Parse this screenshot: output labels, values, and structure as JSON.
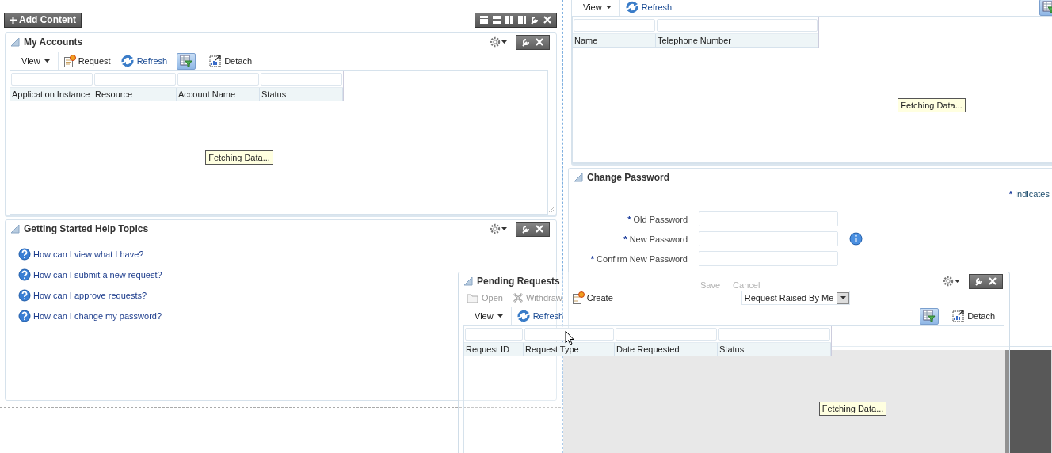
{
  "header": {
    "add_content": "Add Content"
  },
  "my_accounts": {
    "title": "My Accounts",
    "toolbar": [
      {
        "kind": "menu",
        "label": "View"
      },
      {
        "kind": "new",
        "label": "Request"
      },
      {
        "kind": "refresh",
        "label": "Refresh"
      },
      {
        "kind": "filter",
        "selected": true
      },
      {
        "kind": "detach",
        "label": "Detach"
      }
    ],
    "columns": [
      "Application Instance",
      "Resource",
      "Account Name",
      "Status"
    ],
    "status": "Fetching Data..."
  },
  "help_topics": {
    "title": "Getting Started Help Topics",
    "links": [
      "How can I view what I have?",
      "How can I submit a new request?",
      "How can I approve requests?",
      "How can I change my password?"
    ]
  },
  "contacts": {
    "toolbar": [
      {
        "kind": "menu",
        "label": "View"
      },
      {
        "kind": "refresh",
        "label": "Refresh"
      }
    ],
    "filter_selected": true,
    "columns": [
      "Name",
      "Telephone Number"
    ],
    "status": "Fetching Data..."
  },
  "change_password": {
    "title": "Change Password",
    "note_marker": "*",
    "note": "Indicates",
    "fields": [
      {
        "marker": "*",
        "label": "Old Password",
        "info": false
      },
      {
        "marker": "*",
        "label": "New Password",
        "info": true
      },
      {
        "marker": "*",
        "label": "Confirm New Password",
        "info": false
      }
    ],
    "buttons": [
      {
        "label": "Save",
        "disabled": true
      },
      {
        "label": "Cancel",
        "disabled": true
      }
    ]
  },
  "pending_requests": {
    "title": "Pending Requests",
    "actions": [
      {
        "kind": "folder",
        "label": "Open",
        "disabled": true
      },
      {
        "kind": "remove",
        "label": "Withdraw",
        "disabled": true
      },
      {
        "kind": "new",
        "label": "Create",
        "disabled": false
      }
    ],
    "dropdown": {
      "value": "Request Raised By Me"
    },
    "toolbar": [
      {
        "kind": "menu",
        "label": "View"
      },
      {
        "kind": "refresh",
        "label": "Refresh"
      }
    ],
    "toolbar_right": [
      {
        "kind": "filter",
        "selected": true
      },
      {
        "kind": "detach",
        "label": "Detach"
      }
    ],
    "columns": [
      "Request ID",
      "Request Type",
      "Date Requested",
      "Status"
    ],
    "status": "Fetching Data..."
  }
}
